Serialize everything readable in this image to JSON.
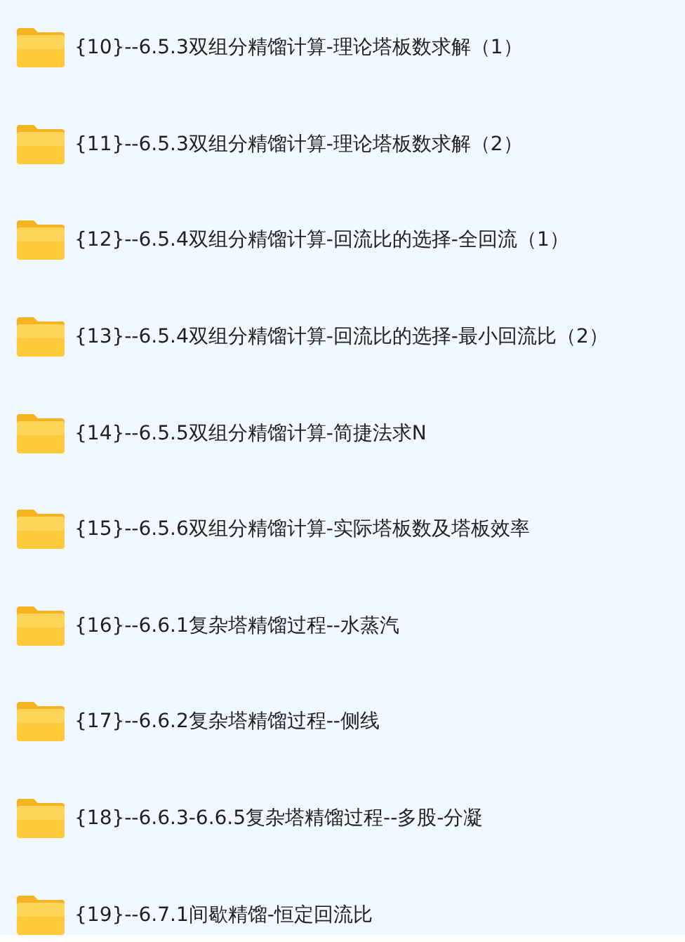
{
  "folders": [
    {
      "name": "{10}--6.5.3双组分精馏计算-理论塔板数求解（1）"
    },
    {
      "name": "{11}--6.5.3双组分精馏计算-理论塔板数求解（2）"
    },
    {
      "name": "{12}--6.5.4双组分精馏计算-回流比的选择-全回流（1）"
    },
    {
      "name": "{13}--6.5.4双组分精馏计算-回流比的选择-最小回流比（2）"
    },
    {
      "name": "{14}--6.5.5双组分精馏计算-简捷法求N"
    },
    {
      "name": "{15}--6.5.6双组分精馏计算-实际塔板数及塔板效率"
    },
    {
      "name": "{16}--6.6.1复杂塔精馏过程--水蒸汽"
    },
    {
      "name": "{17}--6.6.2复杂塔精馏过程--侧线"
    },
    {
      "name": "{18}--6.6.3-6.6.5复杂塔精馏过程--多股-分凝"
    },
    {
      "name": "{19}--6.7.1间歇精馏-恒定回流比"
    }
  ]
}
